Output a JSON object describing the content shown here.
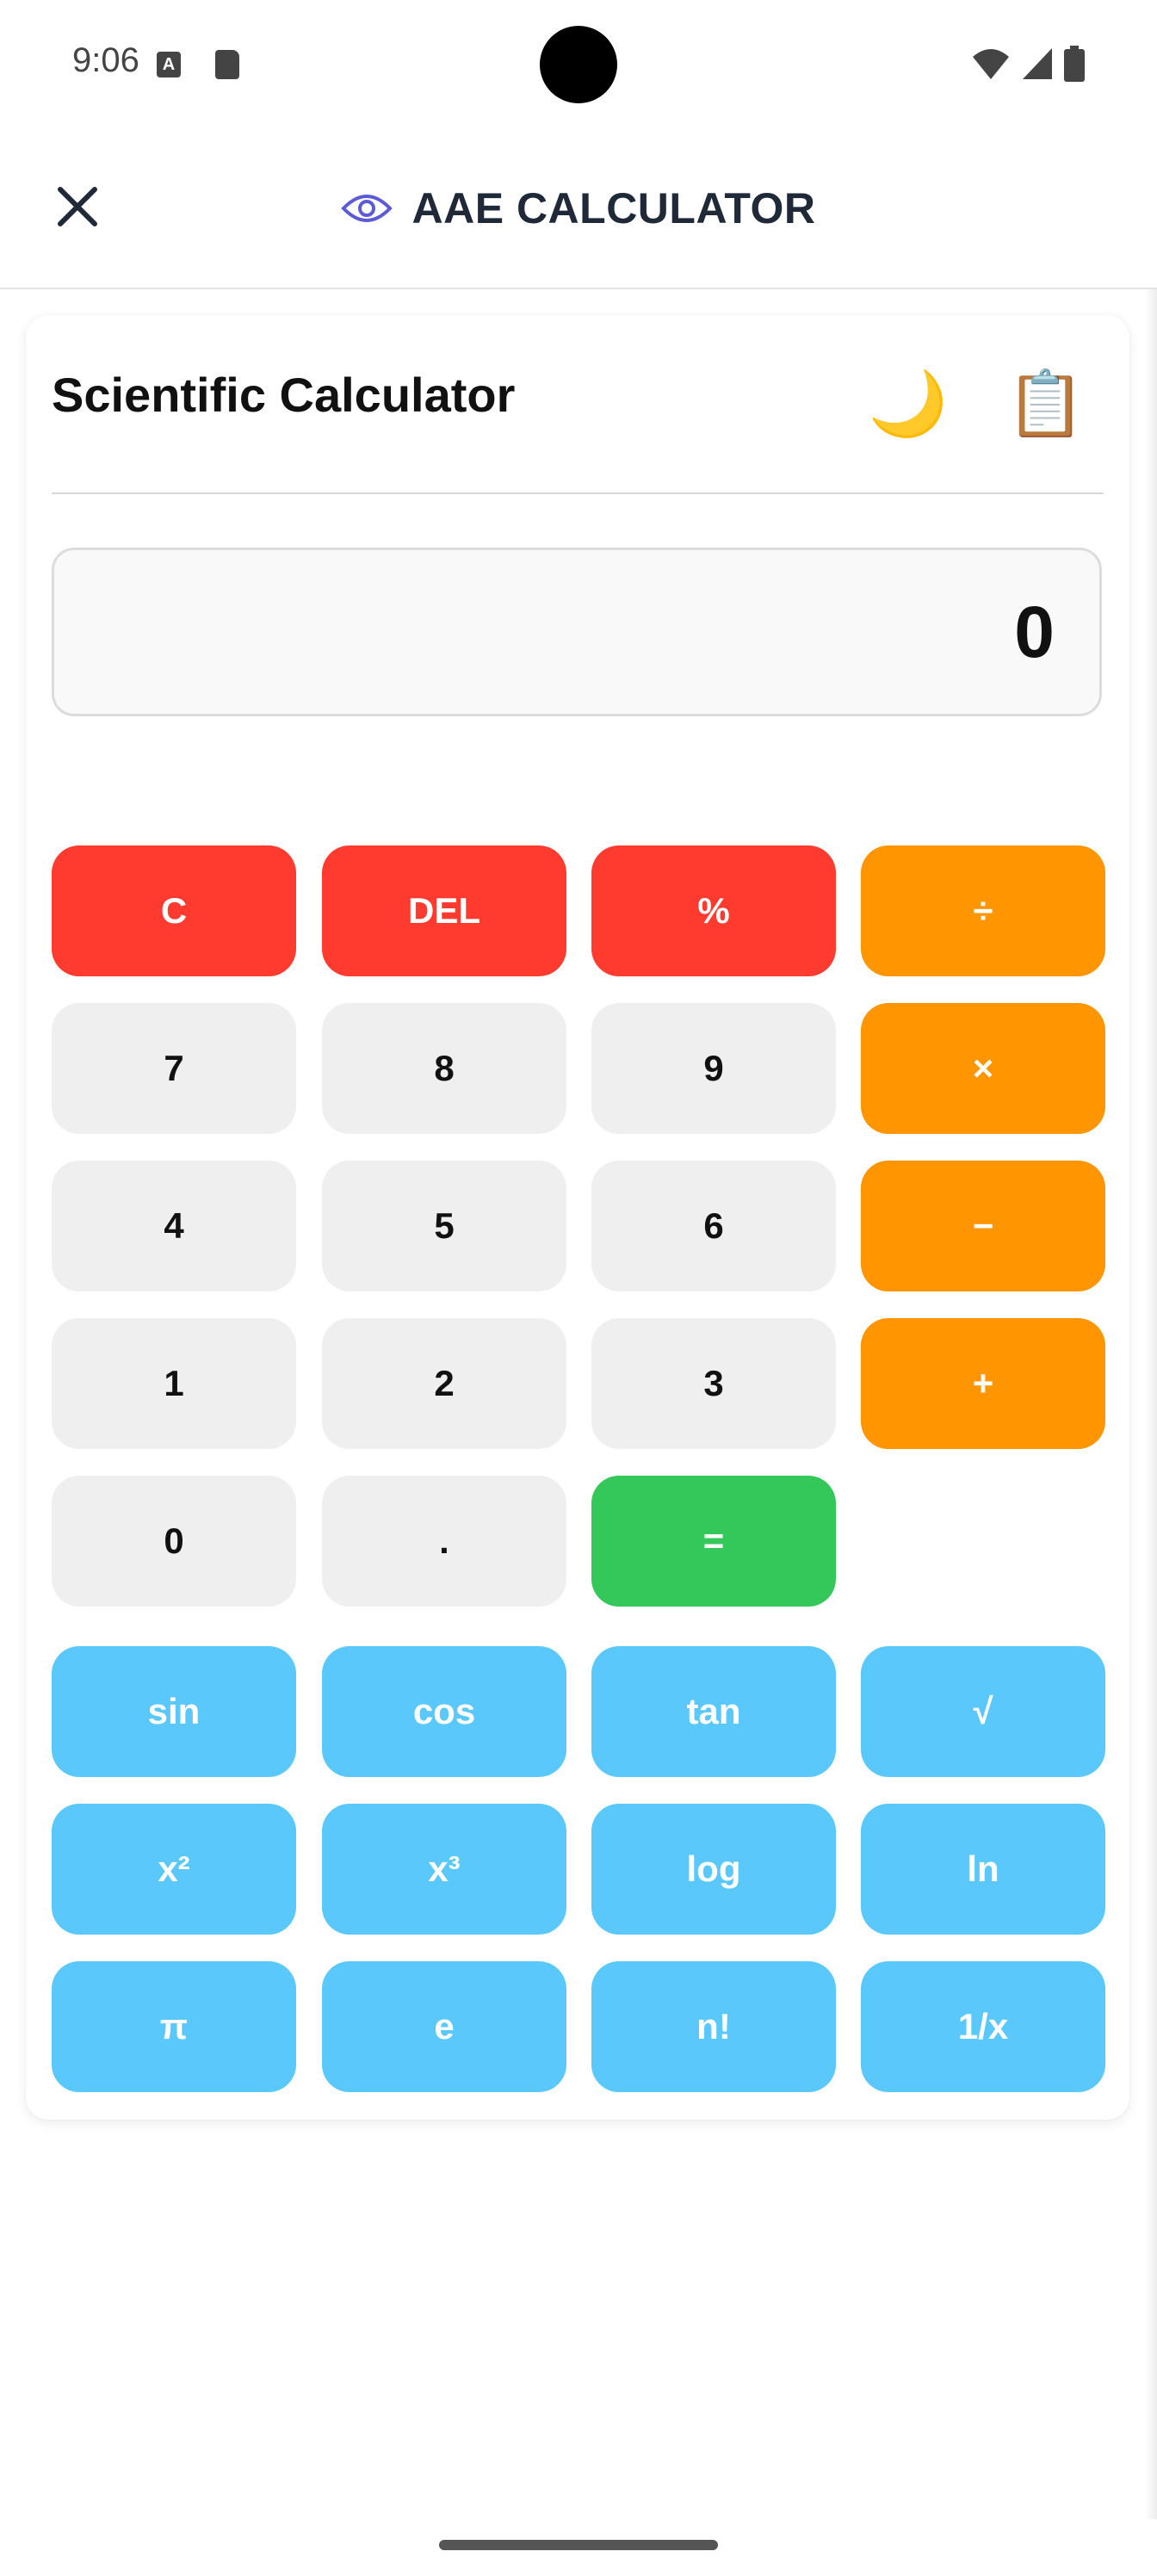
{
  "status_bar": {
    "time": "9:06"
  },
  "app_bar": {
    "title": "AAE CALCULATOR",
    "accent_color": "#5b5bd6"
  },
  "calculator": {
    "title": "Scientific Calculator",
    "theme_icon": "🌙",
    "copy_icon": "📋",
    "display_value": "0",
    "rows": {
      "row1": [
        "C",
        "DEL",
        "%",
        "÷"
      ],
      "row2": [
        "7",
        "8",
        "9",
        "×"
      ],
      "row3": [
        "4",
        "5",
        "6",
        "−"
      ],
      "row4": [
        "1",
        "2",
        "3",
        "+"
      ],
      "row5": [
        "0",
        ".",
        "="
      ],
      "sci1": [
        "sin",
        "cos",
        "tan",
        "√"
      ],
      "sci2": [
        "x²",
        "x³",
        "log",
        "ln"
      ],
      "sci3": [
        "π",
        "e",
        "n!",
        "1/x"
      ]
    },
    "colors": {
      "clear": "#ff3b30",
      "operator": "#ff9500",
      "digit": "#efefef",
      "equals": "#34c759",
      "scientific": "#5ac8fa"
    }
  }
}
